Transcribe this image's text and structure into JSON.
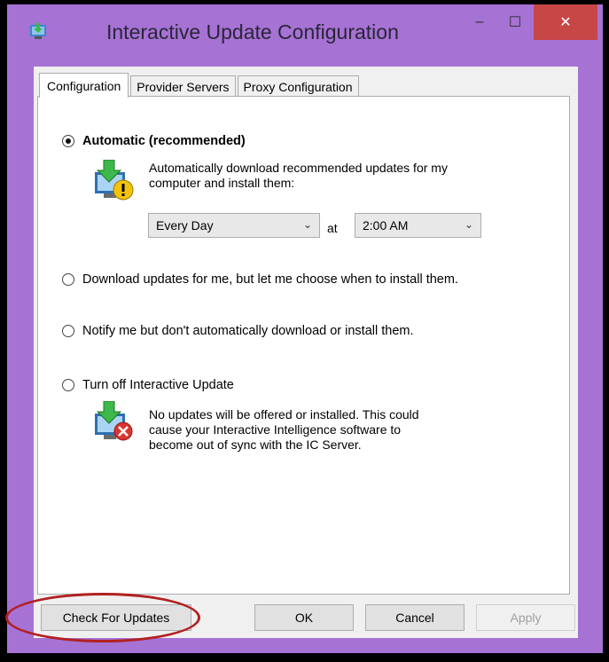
{
  "window": {
    "title": "Interactive Update Configuration",
    "controls": {
      "minimize": "–",
      "maximize": "☐",
      "close": "✕"
    }
  },
  "tabs": [
    {
      "label": "Configuration",
      "active": true
    },
    {
      "label": "Provider Servers",
      "active": false
    },
    {
      "label": "Proxy Configuration",
      "active": false
    }
  ],
  "options": {
    "automatic": {
      "label": "Automatic (recommended)",
      "checked": true,
      "description_line1": "Automatically download recommended updates for my",
      "description_line2": "computer and install them:",
      "icon": "update-warning-icon"
    },
    "download": {
      "label": "Download updates for me, but let me choose when to install them.",
      "checked": false
    },
    "notify": {
      "label": "Notify me but don't automatically download or install them.",
      "checked": false
    },
    "turnoff": {
      "label": "Turn off Interactive Update",
      "checked": false,
      "description_line1": "No updates will be offered or installed.  This could",
      "description_line2": "cause your Interactive Intelligence software to",
      "description_line3": "become out of sync with the IC Server.",
      "icon": "update-error-icon"
    }
  },
  "schedule": {
    "frequency": "Every Day",
    "at_label": "at",
    "time": "2:00 AM"
  },
  "buttons": {
    "check": "Check For Updates",
    "ok": "OK",
    "cancel": "Cancel",
    "apply": "Apply"
  },
  "colors": {
    "window_frame": "#a672d4",
    "close_button": "#c74747",
    "highlight": "#b22020"
  }
}
